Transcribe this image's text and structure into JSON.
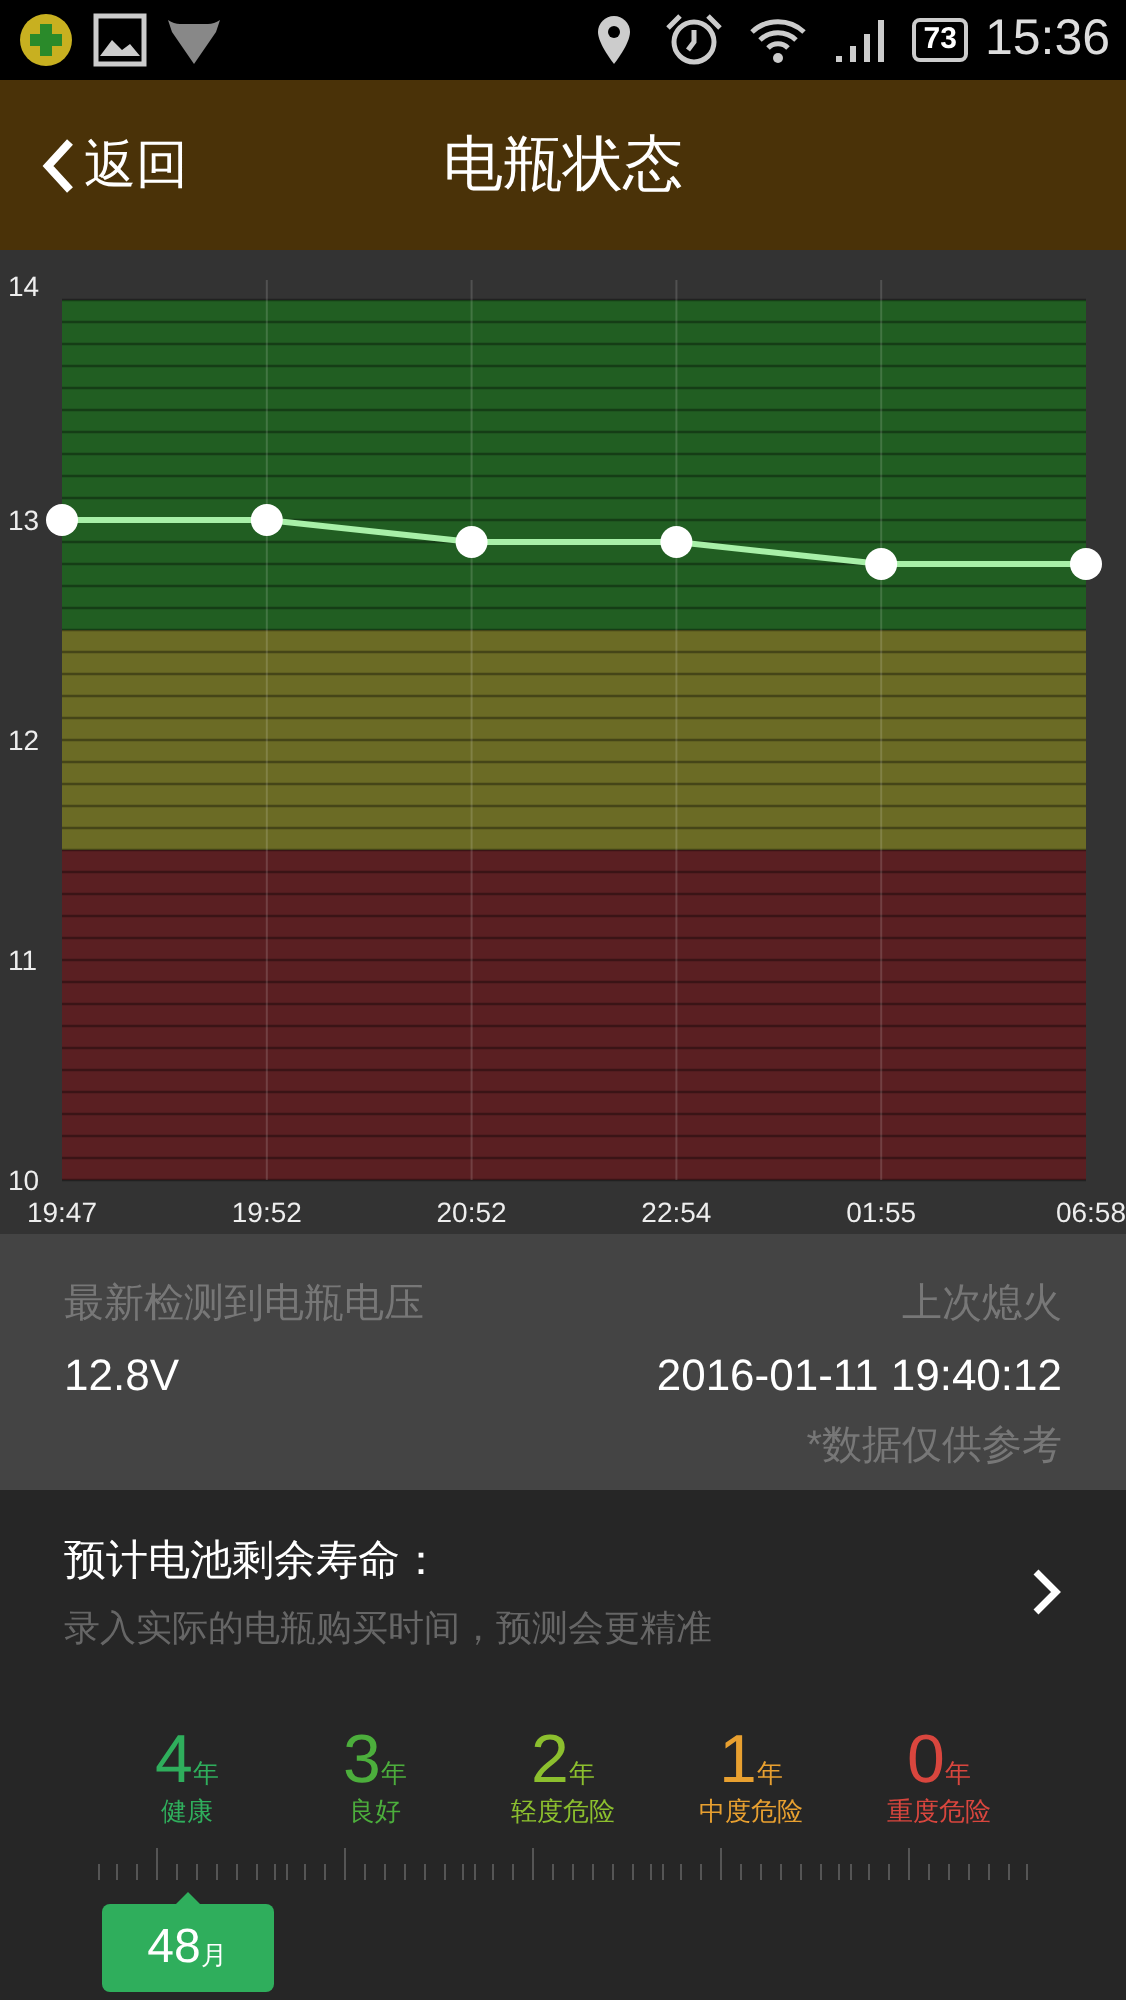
{
  "status_bar": {
    "battery": "73",
    "time": "15:36"
  },
  "header": {
    "back": "返回",
    "title": "电瓶状态"
  },
  "chart_data": {
    "type": "line",
    "categories": [
      "19:47",
      "19:52",
      "20:52",
      "22:54",
      "01:55",
      "06:58"
    ],
    "series": [
      {
        "color": "#a8f0a8",
        "marker": "circle",
        "values": [
          13.0,
          13.0,
          12.9,
          12.9,
          12.8,
          12.8
        ]
      }
    ],
    "ylim": [
      10,
      14
    ],
    "yticks": [
      10,
      11,
      12,
      13,
      14
    ],
    "grid": true
  },
  "voltage": {
    "label": "最新检测到电瓶电压",
    "value": "12.8V"
  },
  "last_off": {
    "label": "上次熄火",
    "value": "2016-01-11 19:40:12",
    "note": "*数据仅供参考"
  },
  "life": {
    "title": "预计电池剩余寿命：",
    "subtitle": "录入实际的电瓶购买时间，预测会更精准",
    "items": [
      {
        "value": "4",
        "unit": "年",
        "label": "健康",
        "color": "#2fae5c",
        "selected": true
      },
      {
        "value": "3",
        "unit": "年",
        "label": "良好",
        "color": "#4cae3c",
        "selected": false
      },
      {
        "value": "2",
        "unit": "年",
        "label": "轻度危险",
        "color": "#8cbf2e",
        "selected": false
      },
      {
        "value": "1",
        "unit": "年",
        "label": "中度危险",
        "color": "#e8a030",
        "selected": false
      },
      {
        "value": "0",
        "unit": "年",
        "label": "重度危险",
        "color": "#d9463e",
        "selected": false
      }
    ],
    "marker": {
      "value": "48",
      "unit": "月"
    }
  }
}
